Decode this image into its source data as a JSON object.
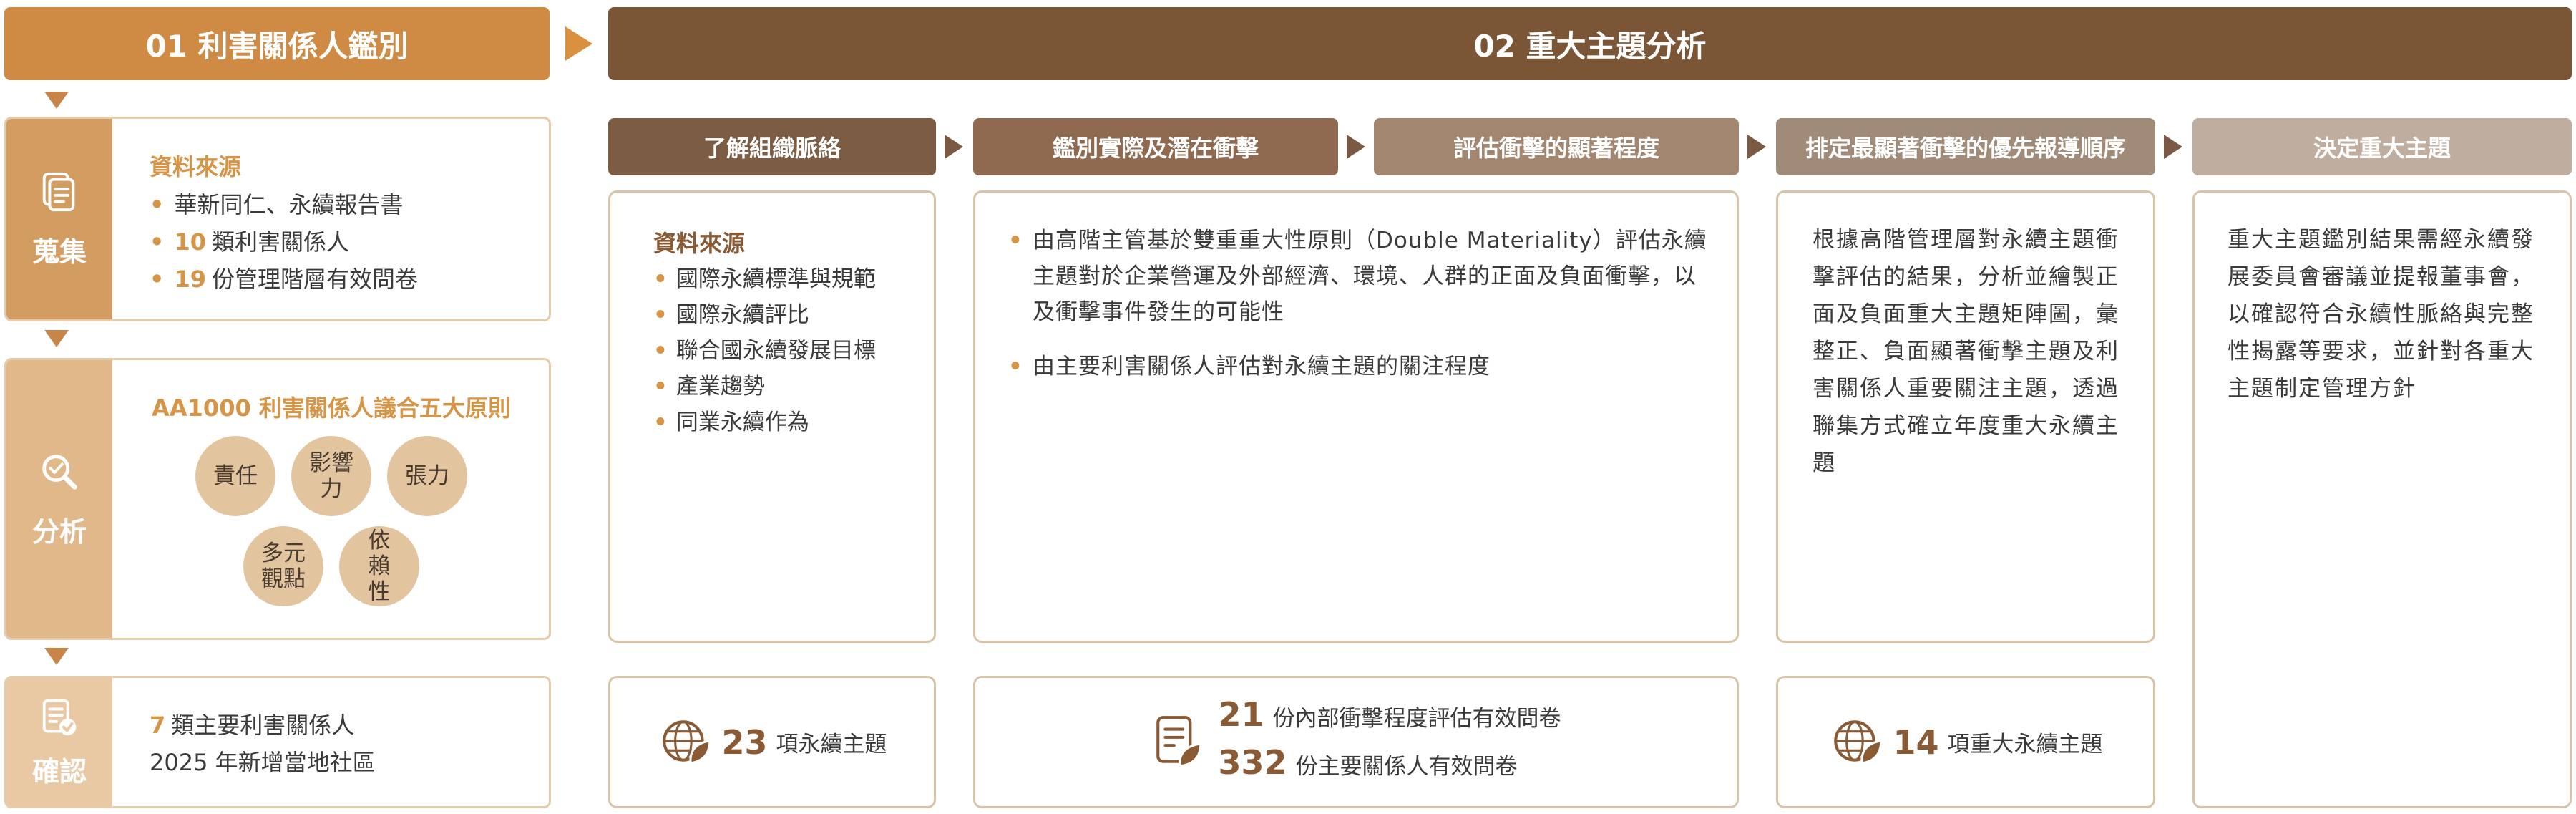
{
  "phases": {
    "p1": "01 利害關係人鑑別",
    "p2": "02 重大主題分析"
  },
  "stages": {
    "collect": {
      "label": "蒐集",
      "title": "資料來源",
      "items": [
        {
          "num": "",
          "text": "華新同仁、永續報告書"
        },
        {
          "num": "10",
          "text": "類利害關係人"
        },
        {
          "num": "19",
          "text": "份管理階層有效問卷"
        }
      ]
    },
    "analyze": {
      "label": "分析",
      "title": "AA1000 利害關係人議合五大原則",
      "principles": [
        "責任",
        "影響力",
        "張力",
        "多元觀點",
        "依賴性"
      ]
    },
    "confirm": {
      "label": "確認",
      "line1_num": "7",
      "line1_text": "類主要利害關係人",
      "line2": "2025 年新增當地社區"
    }
  },
  "steps": {
    "s1": {
      "title": "了解組織脈絡",
      "box_title": "資料來源",
      "items": [
        "國際永續標準與規範",
        "國際永續評比",
        "聯合國永續發展目標",
        "產業趨勢",
        "同業永續作為"
      ],
      "stat_num": "23",
      "stat_text": "項永續主題"
    },
    "s2": {
      "title": "鑑別實際及潛在衝擊",
      "points": [
        "由高階主管基於雙重重大性原則（Double Materiality）評估永續主題對於企業營運及外部經濟、環境、人群的正面及負面衝擊，以及衝擊事件發生的可能性",
        "由主要利害關係人評估對永續主題的關注程度"
      ],
      "stat1_num": "21",
      "stat1_text": "份內部衝擊程度評估有效問卷",
      "stat2_num": "332",
      "stat2_text": "份主要關係人有效問卷"
    },
    "s3": {
      "title": "評估衝擊的顯著程度"
    },
    "s4": {
      "title": "排定最顯著衝擊的優先報導順序",
      "text": "根據高階管理層對永續主題衝擊評估的結果，分析並繪製正面及負面重大主題矩陣圖，彙整正、負面顯著衝擊主題及利害關係人重要關注主題，透過聯集方式確立年度重大永續主題",
      "stat_num": "14",
      "stat_text": "項重大永續主題"
    },
    "s5": {
      "title": "決定重大主題",
      "text": "重大主題鑑別結果需經永續發展委員會審議並提報董事會，以確認符合永續性脈絡與完整性揭露等要求，並針對各重大主題制定管理方針"
    }
  },
  "colors": {
    "phase1": "#cf8b44",
    "phase2": "#7a5536",
    "accent": "#d59446",
    "step1": "#7d5c44",
    "step2": "#8f6a51",
    "step3": "#a38670",
    "step4": "#a08a78",
    "step5": "#bfae9f"
  }
}
